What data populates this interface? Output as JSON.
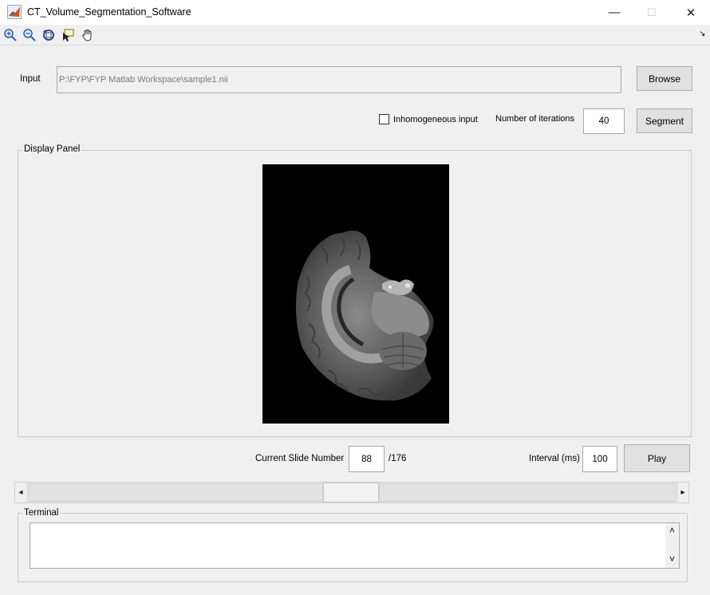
{
  "window": {
    "title": "CT_Volume_Segmentation_Software",
    "minimize": "—",
    "maximize": "☐",
    "close": "✕"
  },
  "toolbar": {
    "icons": [
      "zoom-in-icon",
      "zoom-out-icon",
      "rotate-3d-icon",
      "data-cursor-icon",
      "pan-hand-icon"
    ],
    "dock_arrow": "↘"
  },
  "input": {
    "label": "Input",
    "path": "P:\\FYP\\FYP Matlab Workspace\\sample1.nii",
    "browse_label": "Browse"
  },
  "options": {
    "inhomogeneous_label": "Inhomogeneous input",
    "inhomogeneous_checked": false,
    "iterations_label": "Number of iterations",
    "iterations_value": "40",
    "segment_label": "Segment"
  },
  "display_panel": {
    "title": "Display Panel"
  },
  "playback": {
    "slide_label": "Current Slide Number",
    "slide_value": "88",
    "slide_total": "/176",
    "interval_label": "Interval (ms)",
    "interval_value": "100",
    "play_label": "Play",
    "slider_left_arrow": "◂",
    "slider_right_arrow": "▸",
    "slider_position": 0.5
  },
  "terminal": {
    "title": "Terminal",
    "content": "",
    "scroll_up": "˄",
    "scroll_down": "˅"
  },
  "colors": {
    "window_bg": "#f0f0f0",
    "image_bg": "#000000"
  }
}
